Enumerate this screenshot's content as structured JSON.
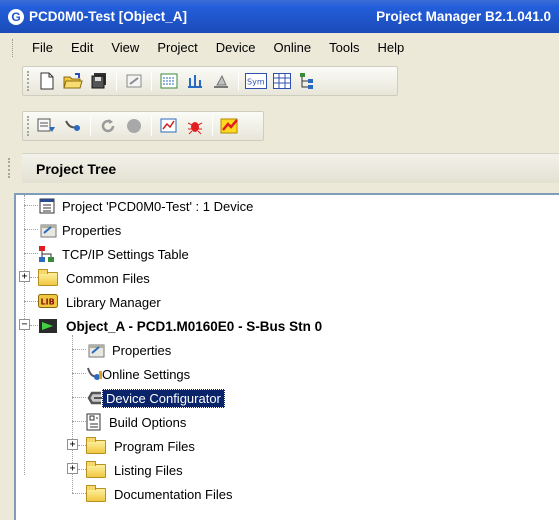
{
  "window": {
    "title_left": "PCD0M0-Test [Object_A]",
    "title_right": "Project Manager B2.1.041.0",
    "logo_glyph": "G"
  },
  "menu": [
    "File",
    "Edit",
    "View",
    "Project",
    "Device",
    "Online",
    "Tools",
    "Help"
  ],
  "toolbar1": {
    "icons": [
      "new-file-icon",
      "open-folder-icon",
      "save-all-icon",
      "properties-icon",
      "build-icon",
      "rebuild-icon",
      "clean-icon",
      "symbols-icon",
      "table-icon",
      "tree-icon"
    ],
    "sym_label": "Sym"
  },
  "toolbar2": {
    "icons": [
      "download-icon",
      "online-settings-icon",
      "refresh-icon",
      "stop-icon",
      "debug-icon",
      "bug-icon",
      "configurator-icon"
    ]
  },
  "pane": {
    "title": "Project Tree"
  },
  "tree": {
    "project": "Project 'PCD0M0-Test' : 1 Device",
    "project_properties": "Properties",
    "tcpip": "TCP/IP Settings Table",
    "common_files": "Common Files",
    "library_manager": "Library Manager",
    "library_badge": "LIB",
    "device": "Object_A - PCD1.M0160E0 - S-Bus Stn 0",
    "device_properties": "Properties",
    "online_settings": "Online Settings",
    "device_configurator": "Device Configurator",
    "build_options": "Build Options",
    "program_files": "Program Files",
    "listing_files": "Listing Files",
    "documentation_files": "Documentation Files",
    "expand_plus": "+",
    "expand_minus": "−"
  },
  "colors": {
    "title_blue": "#1f55c9",
    "selection": "#0a246a",
    "folder_yellow": "#f0c840",
    "background": "#ece9d8"
  }
}
